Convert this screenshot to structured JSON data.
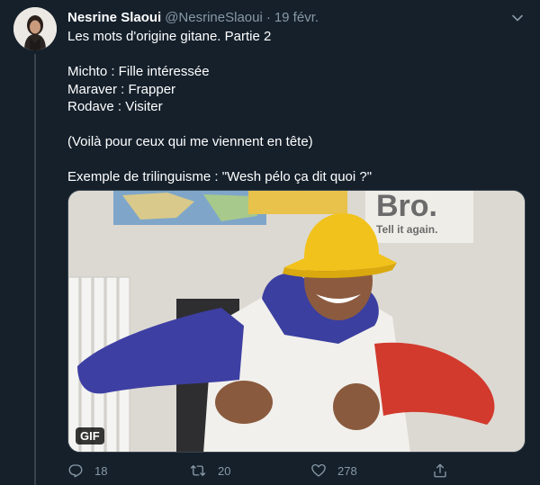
{
  "tweet": {
    "author_name": "Nesrine Slaoui",
    "author_handle": "@NesrineSlaoui",
    "separator": "·",
    "date": "19 févr.",
    "text_lines": {
      "l1": "Les mots d'origine gitane. Partie 2",
      "l2": "Michto : Fille intéressée",
      "l3": "Maraver : Frapper",
      "l4": "Rodave : Visiter",
      "l5": "(Voilà pour ceux qui me viennent en tête)",
      "l6": "Exemple de trilinguisme : \"Wesh pélo ça dit quoi ?\""
    },
    "media": {
      "badge": "GIF",
      "poster_line1": "Bro.",
      "poster_line2": "Tell it again."
    },
    "stats": {
      "replies": "18",
      "retweets": "20",
      "likes": "278"
    },
    "icons": {
      "reply": "reply-icon",
      "retweet": "retweet-icon",
      "like": "heart-icon",
      "share": "share-icon",
      "caret": "chevron-down-icon"
    },
    "colors": {
      "background": "#15202b",
      "muted": "#8899a6",
      "border": "#38444d",
      "text": "#ffffff"
    }
  }
}
